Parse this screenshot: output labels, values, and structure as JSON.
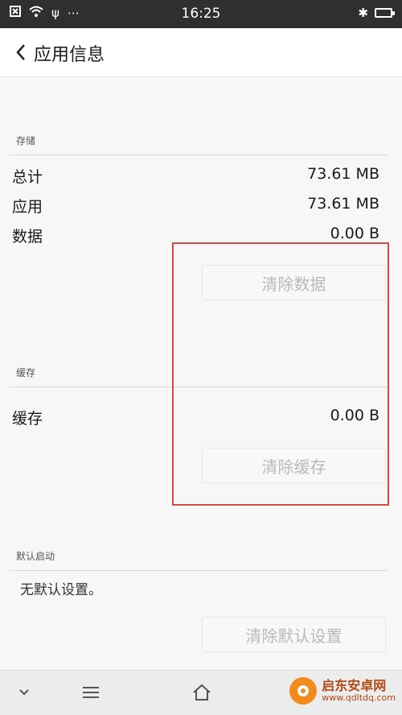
{
  "status_bar": {
    "time": "16:25",
    "left_icons": [
      "close-box-icon",
      "wifi-icon",
      "usb-icon",
      "more-dots-icon"
    ],
    "right_icons": [
      "bluetooth-icon",
      "battery-icon"
    ]
  },
  "header": {
    "title": "应用信息"
  },
  "storage": {
    "section_label": "存储",
    "rows": [
      {
        "label": "总计",
        "value": "73.61 MB"
      },
      {
        "label": "应用",
        "value": "73.61 MB"
      },
      {
        "label": "数据",
        "value": "0.00 B"
      }
    ],
    "clear_button": "清除数据"
  },
  "cache": {
    "section_label": "缓存",
    "row": {
      "label": "缓存",
      "value": "0.00 B"
    },
    "clear_button": "清除缓存"
  },
  "default_launch": {
    "section_label": "默认启动",
    "text": "无默认设置。",
    "clear_button": "清除默认设置"
  },
  "nav": {
    "icons": [
      "chevron-down-icon",
      "menu-icon",
      "home-icon"
    ]
  },
  "watermark": {
    "title": "启东安卓网",
    "url": "www.qdltdq.com"
  },
  "colors": {
    "highlight": "#d44a46",
    "status_bar": "#2f2f2f",
    "disabled_text": "#b9b9b9"
  }
}
